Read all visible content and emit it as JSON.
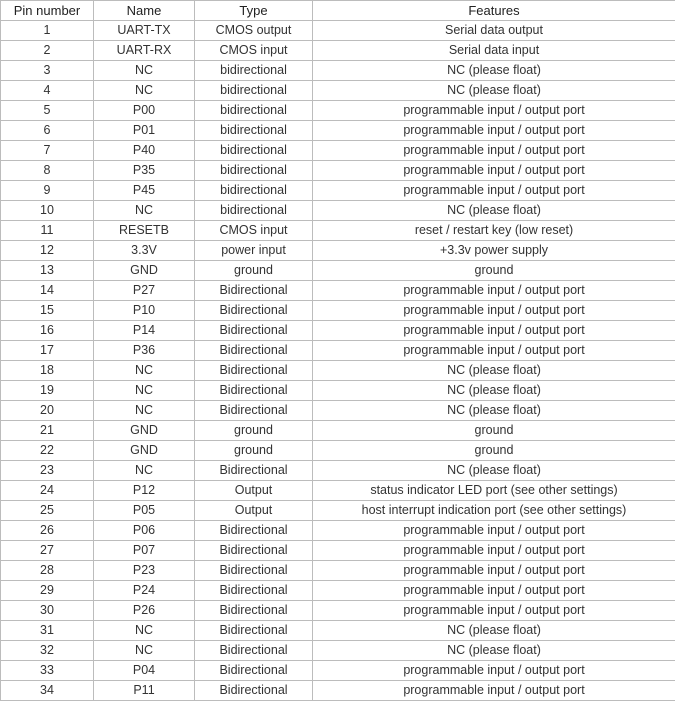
{
  "headers": {
    "pin": "Pin number",
    "name": "Name",
    "type": "Type",
    "features": "Features"
  },
  "rows": [
    {
      "pin": "1",
      "name": "UART-TX",
      "type": "CMOS output",
      "features": "Serial data output"
    },
    {
      "pin": "2",
      "name": "UART-RX",
      "type": "CMOS input",
      "features": "Serial data input"
    },
    {
      "pin": "3",
      "name": "NC",
      "type": "bidirectional",
      "features": "NC (please float)"
    },
    {
      "pin": "4",
      "name": "NC",
      "type": "bidirectional",
      "features": "NC (please float)"
    },
    {
      "pin": "5",
      "name": "P00",
      "type": "bidirectional",
      "features": "programmable input / output port"
    },
    {
      "pin": "6",
      "name": "P01",
      "type": "bidirectional",
      "features": "programmable input / output port"
    },
    {
      "pin": "7",
      "name": "P40",
      "type": "bidirectional",
      "features": "programmable input / output port"
    },
    {
      "pin": "8",
      "name": "P35",
      "type": "bidirectional",
      "features": "programmable input / output port"
    },
    {
      "pin": "9",
      "name": "P45",
      "type": "bidirectional",
      "features": "programmable input / output port"
    },
    {
      "pin": "10",
      "name": "NC",
      "type": "bidirectional",
      "features": "NC (please float)"
    },
    {
      "pin": "11",
      "name": "RESETB",
      "type": "CMOS input",
      "features": "reset / restart key (low reset)"
    },
    {
      "pin": "12",
      "name": "3.3V",
      "type": "power input",
      "features": "+3.3v power supply"
    },
    {
      "pin": "13",
      "name": "GND",
      "type": "ground",
      "features": "ground"
    },
    {
      "pin": "14",
      "name": "P27",
      "type": "Bidirectional",
      "features": "programmable input / output port"
    },
    {
      "pin": "15",
      "name": "P10",
      "type": "Bidirectional",
      "features": "programmable input / output port"
    },
    {
      "pin": "16",
      "name": "P14",
      "type": "Bidirectional",
      "features": "programmable input / output port"
    },
    {
      "pin": "17",
      "name": "P36",
      "type": "Bidirectional",
      "features": "programmable input / output port"
    },
    {
      "pin": "18",
      "name": "NC",
      "type": "Bidirectional",
      "features": "NC (please float)"
    },
    {
      "pin": "19",
      "name": "NC",
      "type": "Bidirectional",
      "features": "NC (please float)"
    },
    {
      "pin": "20",
      "name": "NC",
      "type": "Bidirectional",
      "features": "NC (please float)"
    },
    {
      "pin": "21",
      "name": "GND",
      "type": "ground",
      "features": "ground"
    },
    {
      "pin": "22",
      "name": "GND",
      "type": "ground",
      "features": "ground"
    },
    {
      "pin": "23",
      "name": "NC",
      "type": "Bidirectional",
      "features": "NC (please float)"
    },
    {
      "pin": "24",
      "name": "P12",
      "type": "Output",
      "features": "status indicator LED port (see other settings)"
    },
    {
      "pin": "25",
      "name": "P05",
      "type": "Output",
      "features": "host interrupt indication port (see other settings)"
    },
    {
      "pin": "26",
      "name": "P06",
      "type": "Bidirectional",
      "features": "programmable input / output port"
    },
    {
      "pin": "27",
      "name": "P07",
      "type": "Bidirectional",
      "features": "programmable input / output port"
    },
    {
      "pin": "28",
      "name": "P23",
      "type": "Bidirectional",
      "features": "programmable input / output port"
    },
    {
      "pin": "29",
      "name": "P24",
      "type": "Bidirectional",
      "features": "programmable input / output port"
    },
    {
      "pin": "30",
      "name": "P26",
      "type": "Bidirectional",
      "features": "programmable input / output port"
    },
    {
      "pin": "31",
      "name": "NC",
      "type": "Bidirectional",
      "features": "NC (please float)"
    },
    {
      "pin": "32",
      "name": "NC",
      "type": "Bidirectional",
      "features": "NC (please float)"
    },
    {
      "pin": "33",
      "name": "P04",
      "type": "Bidirectional",
      "features": "programmable input / output port"
    },
    {
      "pin": "34",
      "name": "P11",
      "type": "Bidirectional",
      "features": "programmable input / output port"
    }
  ]
}
